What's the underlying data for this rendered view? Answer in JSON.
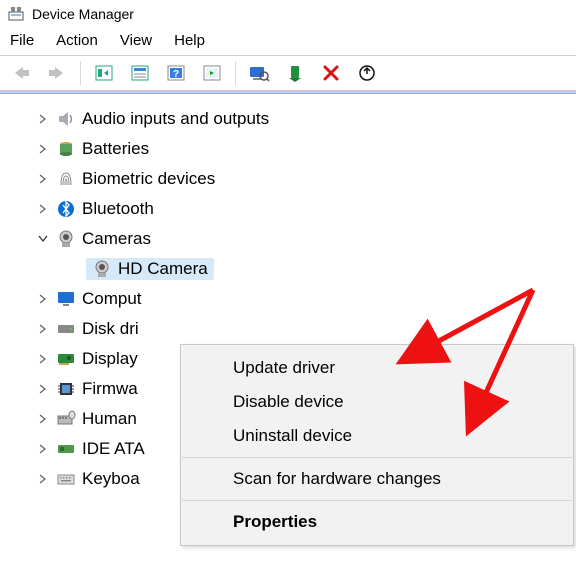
{
  "title": "Device Manager",
  "menu": {
    "file": "File",
    "action": "Action",
    "view": "View",
    "help": "Help"
  },
  "tree": {
    "items": [
      {
        "label": "Audio inputs and outputs",
        "icon": "speaker"
      },
      {
        "label": "Batteries",
        "icon": "battery"
      },
      {
        "label": "Biometric devices",
        "icon": "fingerprint"
      },
      {
        "label": "Bluetooth",
        "icon": "bluetooth"
      },
      {
        "label": "Cameras",
        "icon": "camera",
        "expanded": true,
        "child_label": "HD Camera"
      },
      {
        "label": "Comput",
        "icon": "monitor"
      },
      {
        "label": "Disk dri",
        "icon": "disk"
      },
      {
        "label": "Display",
        "icon": "gpu"
      },
      {
        "label": "Firmwa",
        "icon": "chip"
      },
      {
        "label": "Human",
        "icon": "keyboard"
      },
      {
        "label": "IDE ATA",
        "icon": "ide"
      },
      {
        "label": "Keyboa",
        "icon": "keyboard"
      }
    ]
  },
  "context": {
    "update": "Update driver",
    "disable": "Disable device",
    "uninstall": "Uninstall device",
    "scan": "Scan for hardware changes",
    "properties": "Properties"
  }
}
